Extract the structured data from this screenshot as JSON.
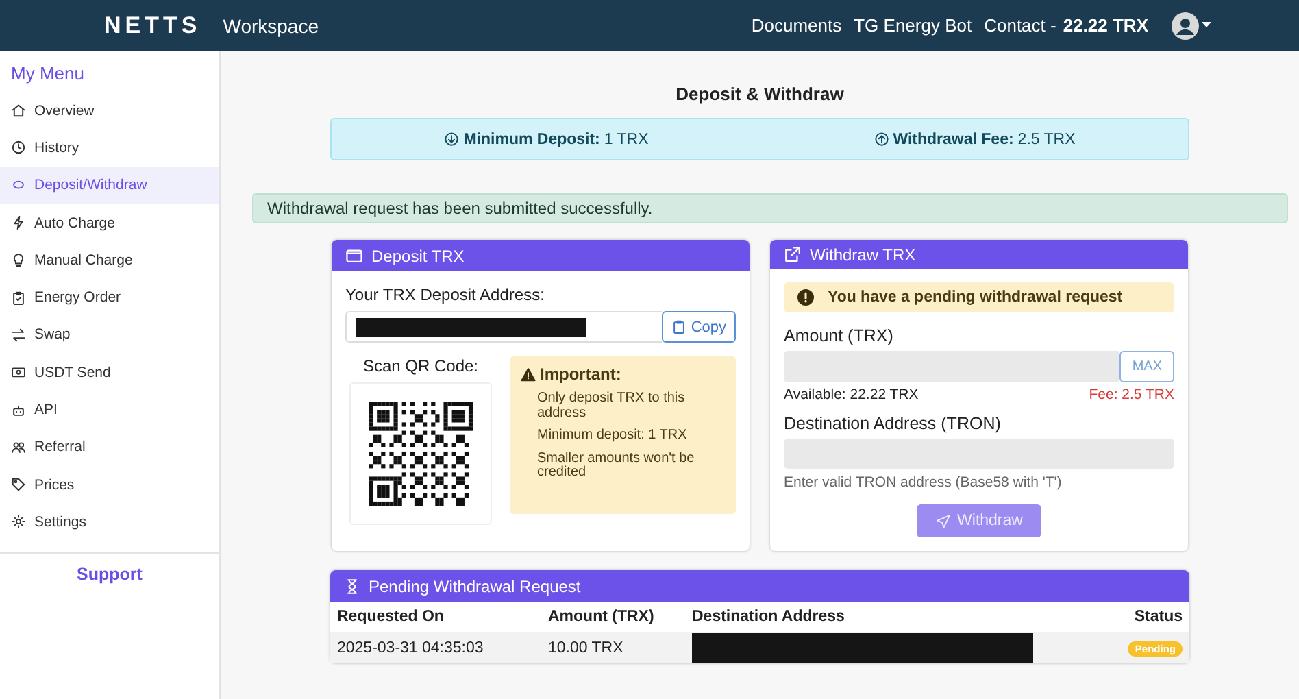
{
  "topbar": {
    "brand": "NETTS",
    "subtitle": "Workspace",
    "links": [
      "Documents",
      "TG Energy Bot",
      "Contact -"
    ],
    "balance": "22.22 TRX"
  },
  "sidebar": {
    "title": "My Menu",
    "items": [
      {
        "label": "Overview",
        "selected": false
      },
      {
        "label": "History",
        "selected": false
      },
      {
        "label": "Deposit/Withdraw",
        "selected": true
      },
      {
        "label": "Auto Charge",
        "selected": false
      },
      {
        "label": "Manual Charge",
        "selected": false
      },
      {
        "label": "Energy Order",
        "selected": false
      },
      {
        "label": "Swap",
        "selected": false
      },
      {
        "label": "USDT Send",
        "selected": false
      },
      {
        "label": "API",
        "selected": false
      },
      {
        "label": "Referral",
        "selected": false
      },
      {
        "label": "Prices",
        "selected": false
      },
      {
        "label": "Settings",
        "selected": false
      }
    ],
    "support": "Support"
  },
  "page_title": "Deposit & Withdraw",
  "info": [
    {
      "label": "Minimum Deposit:",
      "value": "1 TRX"
    },
    {
      "label": "Withdrawal Fee:",
      "value": "2.5 TRX"
    }
  ],
  "alert": "Withdrawal request has been submitted successfully.",
  "deposit": {
    "title": "Deposit TRX",
    "address_label": "Your TRX Deposit Address:",
    "copy": "Copy",
    "qr_label": "Scan QR Code:",
    "important_title": "Important:",
    "notes": [
      "Only deposit TRX to this address",
      "Minimum deposit: 1 TRX",
      "Smaller amounts won't be credited"
    ]
  },
  "withdraw": {
    "title": "Withdraw TRX",
    "warning": "You have a pending withdrawal request",
    "amount_label": "Amount (TRX)",
    "max": "MAX",
    "available": "Available: 22.22 TRX",
    "fee": "Fee: 2.5 TRX",
    "dest_label": "Destination Address (TRON)",
    "hint": "Enter valid TRON address (Base58 with 'T')",
    "button": "Withdraw",
    "disabled": true
  },
  "pending": {
    "title": "Pending Withdrawal Request",
    "columns": [
      "Requested On",
      "Amount (TRX)",
      "Destination Address",
      "Status"
    ],
    "rows": [
      {
        "requested_on": "2025-03-31 04:35:03",
        "amount": "10.00 TRX",
        "status": "Pending"
      }
    ]
  }
}
